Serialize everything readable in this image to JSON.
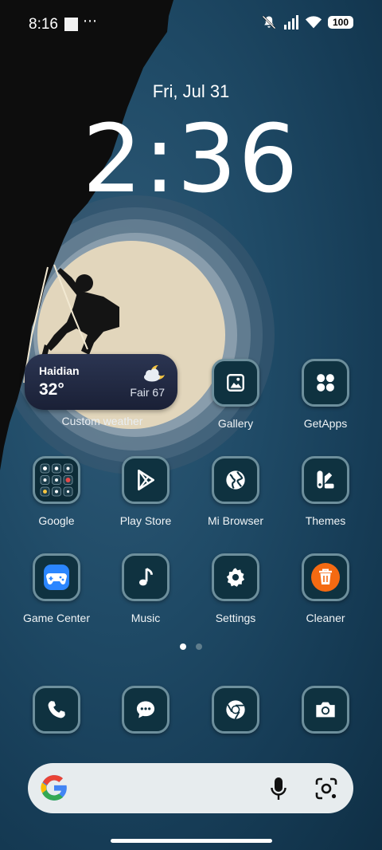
{
  "status_bar": {
    "time": "8:16",
    "overflow": "⋯",
    "battery": "100"
  },
  "lockscreen": {
    "date": "Fri, Jul 31",
    "time": "2:36"
  },
  "weather": {
    "city": "Haidian",
    "temperature": "32°",
    "condition": "Fair 67",
    "label": "Custom weather",
    "icon": "partly-cloudy-night-icon"
  },
  "apps": [
    {
      "label": "Gallery",
      "icon": "gallery-icon"
    },
    {
      "label": "GetApps",
      "icon": "getapps-icon"
    },
    {
      "label": "Google",
      "icon": "google-folder-icon"
    },
    {
      "label": "Play Store",
      "icon": "play-store-icon"
    },
    {
      "label": "Mi Browser",
      "icon": "globe-icon"
    },
    {
      "label": "Themes",
      "icon": "themes-icon"
    },
    {
      "label": "Game Center",
      "icon": "gamepad-icon"
    },
    {
      "label": "Music",
      "icon": "music-note-icon"
    },
    {
      "label": "Settings",
      "icon": "gear-icon"
    },
    {
      "label": "Cleaner",
      "icon": "trash-icon"
    }
  ],
  "dock": [
    {
      "icon": "phone-icon"
    },
    {
      "icon": "messages-icon"
    },
    {
      "icon": "chrome-icon"
    },
    {
      "icon": "camera-icon"
    }
  ],
  "page_indicator": {
    "pages": 2,
    "current": 1
  },
  "colors": {
    "cleaner_orange": "#f46a12",
    "game_center_blue": "#2b86ff",
    "icon_bg": "#0f3240",
    "icon_border": "#6d8f9c"
  }
}
